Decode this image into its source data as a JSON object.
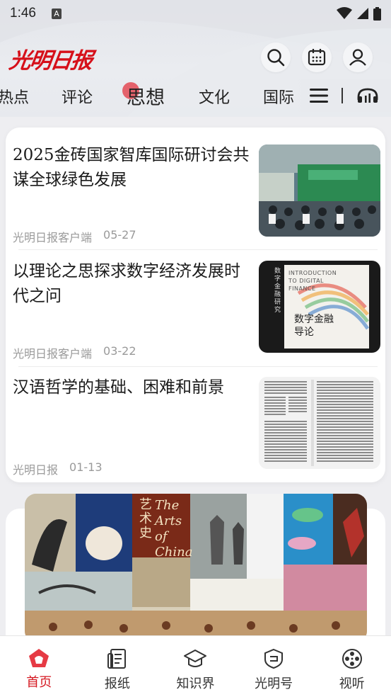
{
  "status_bar": {
    "time": "1:46",
    "notif_letter": "A"
  },
  "header": {
    "logo_text": "光明日报",
    "tabs": [
      {
        "label": "热点",
        "active": false
      },
      {
        "label": "评论",
        "active": false
      },
      {
        "label": "思想",
        "active": true
      },
      {
        "label": "文化",
        "active": false
      },
      {
        "label": "国际",
        "active": false
      }
    ],
    "icons": [
      "search-icon",
      "calendar-icon",
      "user-icon",
      "menu-icon",
      "headphones-icon"
    ]
  },
  "articles": [
    {
      "title": "2025金砖国家智库国际研讨会共谋全球绿色发展",
      "source": "光明日报客户端",
      "date": "05-27"
    },
    {
      "title": "以理论之思探求数字经济发展时代之问",
      "source": "光明日报客户端",
      "date": "03-22"
    },
    {
      "title": "汉语哲学的基础、困难和前景",
      "source": "光明日报",
      "date": "01-13"
    }
  ],
  "thumb_texts": {
    "book_en": "INTRODUCTION TO DIGITAL FINANCE",
    "book_cn_1": "数字金融",
    "book_cn_2": "导论",
    "book_spine": "数字金融研究"
  },
  "banner_texts": {
    "arts": "The Arts of China",
    "cn": "艺术史"
  },
  "bottom_nav": [
    {
      "label": "首页",
      "active": true,
      "icon": "home-icon"
    },
    {
      "label": "报纸",
      "active": false,
      "icon": "newspaper-icon"
    },
    {
      "label": "知识界",
      "active": false,
      "icon": "graduation-cap-icon"
    },
    {
      "label": "光明号",
      "active": false,
      "icon": "shield-icon"
    },
    {
      "label": "视听",
      "active": false,
      "icon": "film-reel-icon"
    }
  ],
  "colors": {
    "brand_red": "#d6101a",
    "active_nav": "#d51720"
  }
}
